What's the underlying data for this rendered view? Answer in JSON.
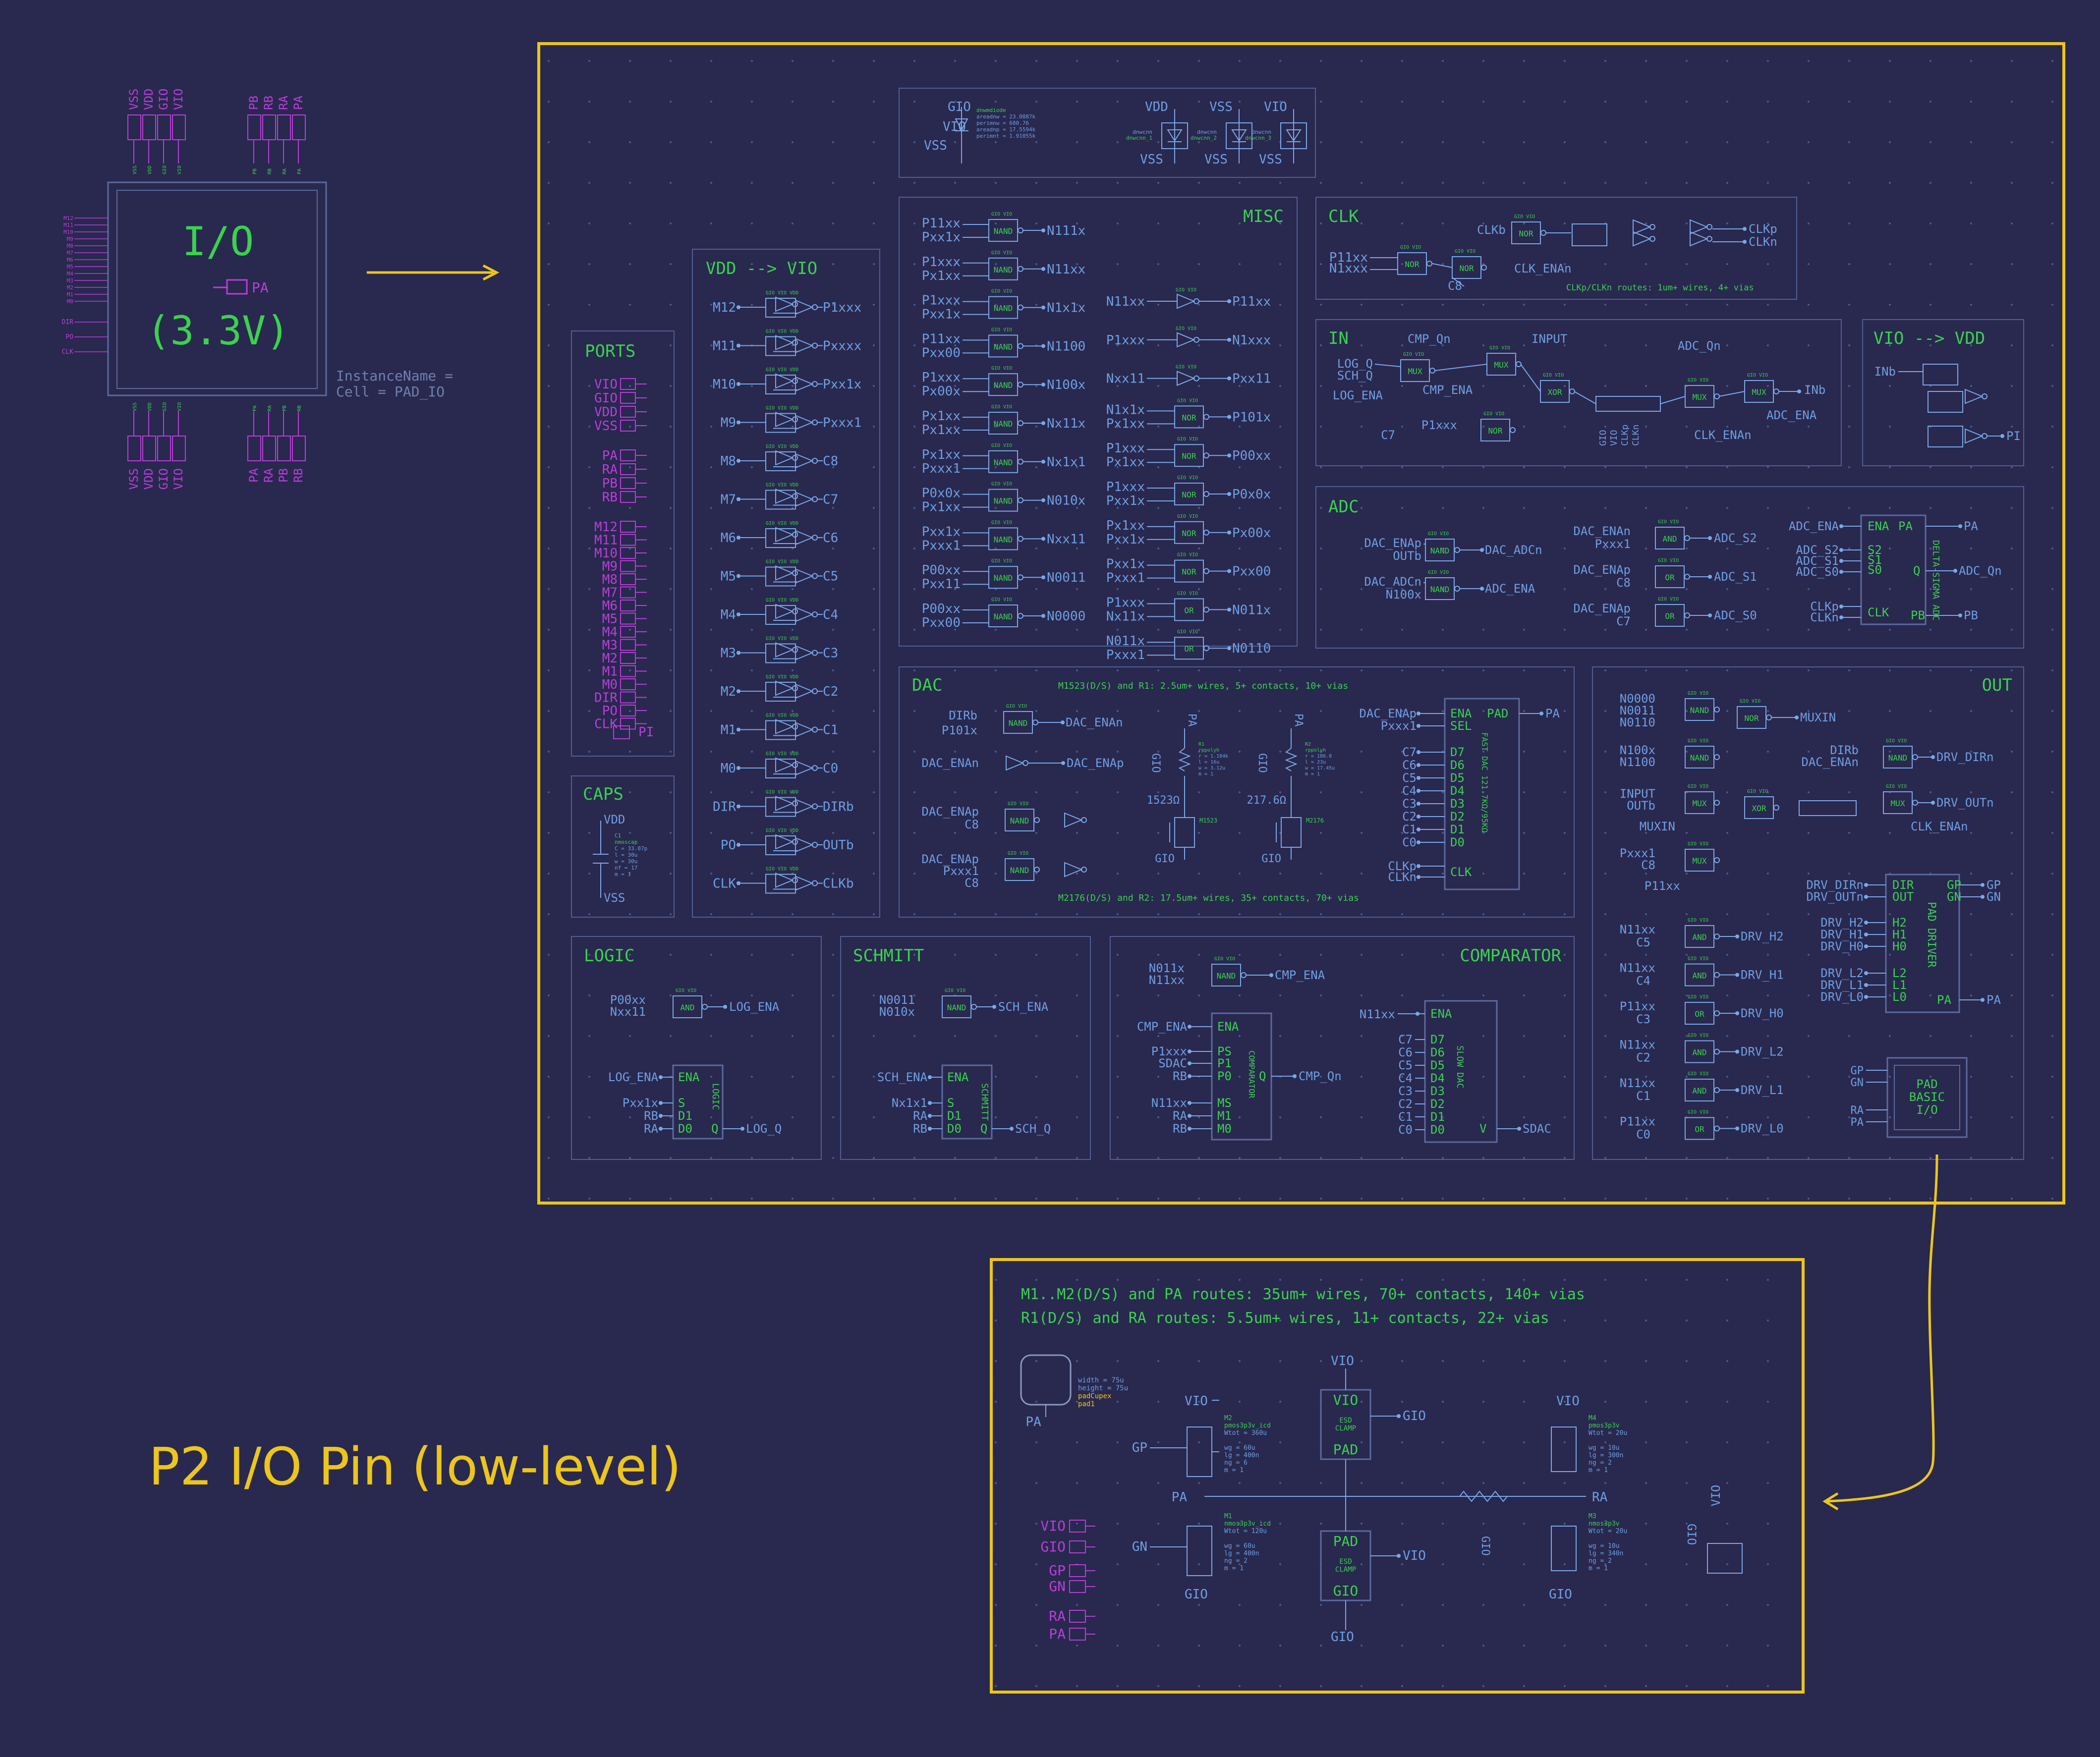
{
  "symbol": {
    "top_left_pins": [
      "VSS",
      "VDD",
      "GIO",
      "VIO"
    ],
    "top_right_pins": [
      "PB",
      "RB",
      "RA",
      "PA"
    ],
    "bottom_left_pins": [
      "VSS",
      "VDD",
      "GIO",
      "VIO"
    ],
    "bottom_right_pins": [
      "PA",
      "RA",
      "PB",
      "RB"
    ],
    "title": "I/O",
    "voltage": "(3.3V)",
    "pa_label": "PA",
    "instance_name": "InstanceName =",
    "cell_name": "Cell = PAD_IO"
  },
  "headline": "P2 I/O Pin (low-level)",
  "ports": {
    "title": "PORTS",
    "groups": [
      [
        "VIO",
        "GIO",
        "VDD",
        "VSS"
      ],
      [
        "PA",
        "RA",
        "PB",
        "RB"
      ],
      [
        "M12",
        "M11",
        "M10",
        "M9",
        "M8",
        "M7",
        "M6",
        "M5",
        "M4",
        "M3",
        "M2",
        "M1",
        "M0",
        "DIR",
        "PO",
        "CLK"
      ]
    ],
    "pi": "PI"
  },
  "caps": {
    "title": "CAPS",
    "vdd": "VDD",
    "vss": "VSS"
  },
  "level_shift": {
    "title": "VDD --> VIO",
    "inputs": [
      "M12",
      "M11",
      "M10",
      "M9",
      "M8",
      "M7",
      "M6",
      "M5",
      "M4",
      "M3",
      "M2",
      "M1",
      "M0",
      "DIR",
      "PO",
      "CLK"
    ],
    "outputs": [
      "P1xxx",
      "Pxxxx",
      "Pxx1x",
      "Pxxx1",
      "C8",
      "C7",
      "C6",
      "C5",
      "C4",
      "C3",
      "C2",
      "C1",
      "C0",
      "DIRb",
      "OUTb",
      "CLKb"
    ]
  },
  "esd": {
    "gio": "GIO",
    "vio": "VIO",
    "vss": "VSS",
    "vdd": "VDD"
  },
  "misc": {
    "title": "MISC",
    "nand_rows": [
      {
        "a": "P11xx",
        "b": "Pxx1x",
        "out": "N111x"
      },
      {
        "a": "P1xxx",
        "b": "Px1xx",
        "out": "N11xx"
      },
      {
        "a": "P1xxx",
        "b": "Pxx1x",
        "out": "N1x1x"
      },
      {
        "a": "P11xx",
        "b": "Pxx00",
        "out": "N1100"
      },
      {
        "a": "P1xxx",
        "b": "Px00x",
        "out": "N100x"
      },
      {
        "a": "Px1xx",
        "b": "Px1xx",
        "out": "Nx11x"
      },
      {
        "a": "Px1xx",
        "b": "Pxxx1",
        "out": "Nx1x1"
      },
      {
        "a": "P0x0x",
        "b": "Px1xx",
        "out": "N010x"
      },
      {
        "a": "Pxx1x",
        "b": "Pxxx1",
        "out": "Nxx11"
      },
      {
        "a": "P00xx",
        "b": "Pxx11",
        "out": "N0011"
      },
      {
        "a": "P00xx",
        "b": "Pxx00",
        "out": "N0000"
      }
    ],
    "right_rows": [
      {
        "a": "N11xx",
        "b": "",
        "gate": "",
        "out": "P11xx"
      },
      {
        "a": "P1xxx",
        "b": "",
        "gate": "",
        "out": "N1xxx"
      },
      {
        "a": "Nxx11",
        "b": "",
        "gate": "",
        "out": "Pxx11"
      },
      {
        "a": "N1x1x",
        "b": "Px1xx",
        "gate": "NOR",
        "out": "P101x"
      },
      {
        "a": "P1xxx",
        "b": "Px1xx",
        "gate": "NOR",
        "out": "P00xx"
      },
      {
        "a": "P1xxx",
        "b": "Pxx1x",
        "gate": "NOR",
        "out": "P0x0x"
      },
      {
        "a": "Px1xx",
        "b": "Pxx1x",
        "gate": "NOR",
        "out": "Px00x"
      },
      {
        "a": "Pxx1x",
        "b": "Pxxx1",
        "gate": "NOR",
        "out": "Pxx00"
      },
      {
        "a": "P1xxx",
        "b": "Nx11x",
        "gate": "OR",
        "out": "N011x"
      },
      {
        "a": "N011x",
        "b": "Pxxx1",
        "gate": "OR",
        "out": "N0110"
      }
    ]
  },
  "clk": {
    "title": "CLK",
    "in_a": "P11xx",
    "in_b": "N1xxx",
    "c8": "C8",
    "clkb": "CLKb",
    "clk_ena": "CLK_ENAn",
    "clkp": "CLKp",
    "clkn": "CLKn",
    "note": "CLKp/CLKn routes: 1um+ wires, 4+ vias"
  },
  "vio_vdd": {
    "title": "VIO --> VDD",
    "in": "INb",
    "out": "PI"
  },
  "in_block": {
    "title": "IN",
    "labels": [
      "LOG_Q",
      "SCH_Q",
      "LOG_ENA",
      "CMP_Qn",
      "CMP_ENA",
      "INPUT",
      "C7",
      "P1xxx",
      "ADC_Qn",
      "CLK_ENAn",
      "INb",
      "ADC_ENA"
    ]
  },
  "adc": {
    "title": "ADC",
    "left": [
      {
        "a": "DAC_ENAp",
        "b": "OUTb",
        "out": "DAC_ADCn"
      },
      {
        "a": "DAC_ADCn",
        "b": "N100x",
        "out": "ADC_ENA"
      }
    ],
    "mid": [
      {
        "a": "DAC_ENAn",
        "b": "Pxxx1",
        "gate": "AND",
        "out": "ADC_S2"
      },
      {
        "a": "DAC_ENAp",
        "b": "C8",
        "gate": "OR",
        "out": "ADC_S1"
      },
      {
        "a": "DAC_ENAp",
        "b": "C7",
        "gate": "OR",
        "out": "ADC_S0"
      }
    ],
    "box_inputs": [
      "ADC_ENA",
      "ADC_S2",
      "ADC_S1",
      "ADC_S0",
      "CLKp",
      "CLKn"
    ],
    "box_pins": [
      "ENA",
      "S2",
      "S1",
      "S0",
      "CLK"
    ],
    "box_title": "DELTA-SIGMA ADC",
    "pa": "PA",
    "q": "Q",
    "pb": "PB",
    "adc_qn": "ADC_Qn",
    "pb_out": "PB"
  },
  "dac": {
    "title": "DAC",
    "note_top": "M1523(D/S) and R1: 2.5um+ wires, 5+ contacts, 10+ vias",
    "note_bottom": "M2176(D/S) and R2: 17.5um+ wires, 35+ contacts, 70+ vias",
    "labels": [
      "DIRb",
      "P101x",
      "DAC_ENAn",
      "DAC_ENAp",
      "DAC_ENAp",
      "C8",
      "DAC_ENAp",
      "Pxxx1",
      "C8",
      "DAC_ENA",
      "DAC_ENAp"
    ],
    "gio": "GIO",
    "pa": "PA",
    "box_in": [
      "DAC_ENAp",
      "Pxxx1",
      "C7",
      "C6",
      "C5",
      "C4",
      "C3",
      "C2",
      "C1",
      "C0",
      "CLKp",
      "CLKn"
    ],
    "box_pins": [
      "ENA",
      "SEL",
      "D7",
      "D6",
      "D5",
      "D4",
      "D3",
      "D2",
      "D1",
      "D0",
      "CLK"
    ],
    "box_title": "FAST DAC 121.7KΩ/95KΩ",
    "box_pad": "PAD",
    "box_out": "PA",
    "m1": "M1523",
    "m2": "M2176",
    "v1": "1523Ω",
    "v2": "217.6Ω"
  },
  "out_block": {
    "title": "OUT",
    "labels": [
      "N0000",
      "N0011",
      "N0110",
      "MUXIN",
      "N100x",
      "N1100",
      "DIRb",
      "DAC_ENAn",
      "DRV_DIRn",
      "INPUT",
      "OUTb",
      "MUXIN",
      "DRV_OUTn",
      "CLK_ENAn",
      "Pxxx1",
      "C8",
      "P11xx"
    ],
    "drv_rows": [
      {
        "a": "N11xx",
        "b": "C5",
        "gate": "AND",
        "out": "DRV_H2"
      },
      {
        "a": "N11xx",
        "b": "C4",
        "gate": "AND",
        "out": "DRV_H1"
      },
      {
        "a": "P11xx",
        "b": "C3",
        "gate": "OR",
        "out": "DRV_H0"
      },
      {
        "a": "N11xx",
        "b": "C2",
        "gate": "AND",
        "out": "DRV_L2"
      },
      {
        "a": "N11xx",
        "b": "C1",
        "gate": "AND",
        "out": "DRV_L1"
      },
      {
        "a": "P11xx",
        "b": "C0",
        "gate": "OR",
        "out": "DRV_L0"
      }
    ],
    "driver_in": [
      "DRV_DIRn",
      "DRV_OUTn",
      "DRV_H2",
      "DRV_H1",
      "DRV_H0",
      "DRV_L2",
      "DRV_L1",
      "DRV_L0"
    ],
    "driver_pins": [
      "DIR",
      "OUT",
      "H2",
      "H1",
      "H0",
      "L2",
      "L1",
      "L0"
    ],
    "driver_title": "PAD DRIVER",
    "gp": "GP",
    "gn": "GN",
    "pa": "PA",
    "basic_title": "PAD BASIC I/O",
    "basic_in": [
      "GP",
      "GN",
      "RA",
      "PA"
    ]
  },
  "logic": {
    "title": "LOGIC",
    "a": "P00xx",
    "b": "Nxx11",
    "out": "LOG_ENA",
    "ins": [
      "LOG_ENA",
      "Pxx1x",
      "RB",
      "RA"
    ],
    "pins": [
      "ENA",
      "S",
      "D1",
      "D0"
    ],
    "box": "LOGIC",
    "q": "Q",
    "qout": "LOG_Q"
  },
  "schmitt": {
    "title": "SCHMITT",
    "a": "N0011",
    "b": "N010x",
    "out": "SCH_ENA",
    "ins": [
      "SCH_ENA",
      "Nx1x1",
      "RA",
      "RB"
    ],
    "pins": [
      "ENA",
      "S",
      "D1",
      "D0"
    ],
    "box": "SCHMITT",
    "q": "Q",
    "qout": "SCH_Q"
  },
  "comparator": {
    "title": "COMPARATOR",
    "a": "N011x",
    "b": "N11xx",
    "out": "CMP_ENA",
    "ins": [
      "CMP_ENA",
      "P1xxx",
      "SDAC",
      "RB",
      "N11xx",
      "RA",
      "RB"
    ],
    "pins": [
      "ENA",
      "PS",
      "P1",
      "P0",
      "MS",
      "M1",
      "M0"
    ],
    "box": "COMPARATOR",
    "q": "Q",
    "qout": "CMP_Qn",
    "dac_in_label": "N11xx",
    "dac_ins": [
      "C7",
      "C6",
      "C5",
      "C4",
      "C3",
      "C2",
      "C1",
      "C0"
    ],
    "dac_pins": [
      "ENA",
      "D7",
      "D6",
      "D5",
      "D4",
      "D3",
      "D2",
      "D1",
      "D0"
    ],
    "dac_box": "SLOW DAC",
    "v": "V",
    "sdac": "SDAC"
  },
  "pad": {
    "note1": "M1..M2(D/S) and PA routes: 35um+ wires, 70+ contacts, 140+ vias",
    "note2": "R1(D/S) and RA routes: 5.5um+ wires, 11+ contacts, 22+ vias",
    "pa": "PA",
    "ra": "RA",
    "gp": "GP",
    "gn": "GN",
    "vio": "VIO",
    "gio": "GIO",
    "esd_top": [
      "VIO",
      "ESD CLAMP",
      "PAD"
    ],
    "esd_bot": [
      "PAD",
      "ESD CLAMP",
      "GIO"
    ],
    "ports": [
      "VIO",
      "GIO",
      "GP",
      "GN",
      "RA",
      "PA"
    ]
  },
  "colors": {
    "background": "#29284f",
    "frame": "#ecc61a",
    "wire": "#7aa8e6",
    "label": "#6e9fe0",
    "green": "#3ad24e",
    "magenta": "#b93ed8",
    "box": "#5b6a9e"
  }
}
